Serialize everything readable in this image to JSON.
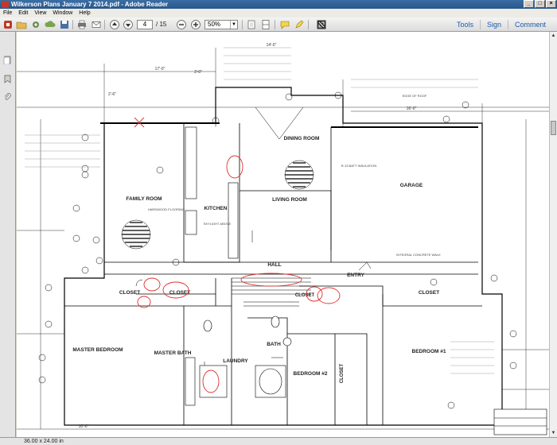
{
  "window": {
    "title": "Wilkerson Plans January 7  2014.pdf - Adobe Reader"
  },
  "menu": [
    "File",
    "Edit",
    "View",
    "Window",
    "Help"
  ],
  "toolbar": {
    "page_current": "4",
    "page_total": "/ 15",
    "zoom": "50%",
    "links": [
      "Tools",
      "Sign",
      "Comment"
    ]
  },
  "status": {
    "page_size": "36.00 x 24.00 in"
  },
  "plan": {
    "rooms": [
      "FAMILY ROOM",
      "KITCHEN",
      "DINING ROOM",
      "LIVING ROOM",
      "GARAGE",
      "HALL",
      "ENTRY",
      "CLOSET",
      "CLOSET",
      "CLOSET",
      "CLOSET",
      "MASTER BEDROOM",
      "MASTER BATH",
      "LAUNDRY",
      "BATH",
      "BEDROOM #2",
      "CLOSET",
      "BEDROOM #1"
    ],
    "dims": [
      "17'-0\"",
      "14'-0\"",
      "16'-0\"",
      "3'-0\"",
      "2'-6\"",
      "10'-0\""
    ],
    "notes": [
      "HARDWOOD FLOORING",
      "SKYLIGHT ABOVE",
      "INTEGRAL CONCRETE WALK",
      "EDGE OF ROOF",
      "R-13 BATT INSULATION"
    ]
  },
  "colors": {
    "accent": "#1e5aa8",
    "markup": "#e03030"
  }
}
